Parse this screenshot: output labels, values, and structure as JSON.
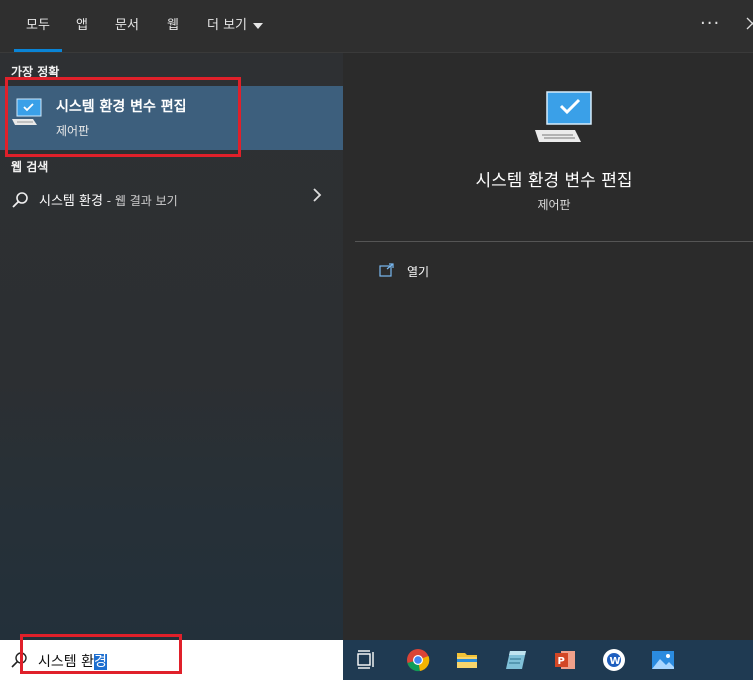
{
  "tabs": [
    {
      "label": "모두"
    },
    {
      "label": "앱"
    },
    {
      "label": "문서"
    },
    {
      "label": "웹"
    },
    {
      "label": "더 보기"
    }
  ],
  "more_label": "···",
  "best_match": {
    "section_label": "가장 정확",
    "title": "시스템 환경 변수 편집",
    "subtitle": "제어판"
  },
  "web_search": {
    "section_label": "웹 검색",
    "query": "시스템 환경",
    "suffix": " - 웹 결과 보기"
  },
  "detail": {
    "title": "시스템 환경 변수 편집",
    "subtitle": "제어판",
    "open_label": "열기"
  },
  "search": {
    "value_plain": "시스템 환",
    "value_selected": "경"
  },
  "colors": {
    "tab_underline": "#0a84d6",
    "best_match_bg": "#3d5f7d",
    "highlight_box": "#e0202a",
    "selection": "#1e6fd0",
    "taskbar": "#1f3a52"
  },
  "taskbar_icons": [
    "task-view-icon",
    "chrome-icon",
    "file-explorer-icon",
    "notepad-icon",
    "powerpoint-icon",
    "word-app-icon",
    "photos-icon"
  ]
}
